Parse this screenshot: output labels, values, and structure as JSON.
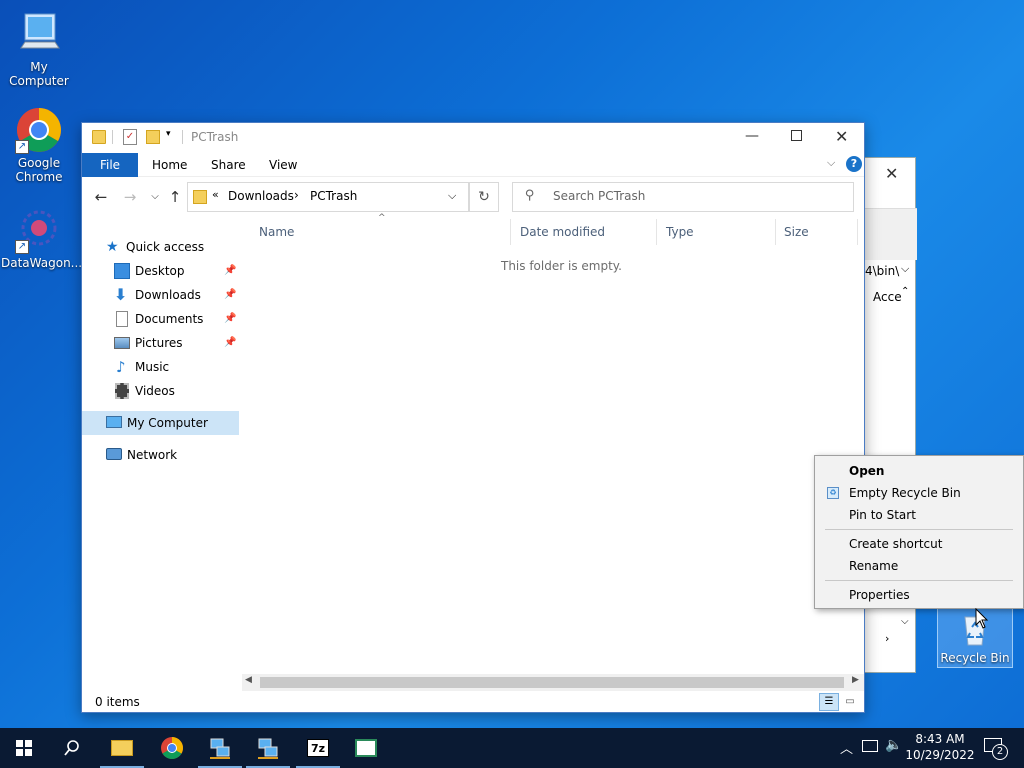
{
  "desktop": {
    "icons": [
      {
        "label": "My Computer"
      },
      {
        "label": "Google Chrome"
      },
      {
        "label": "DataWagon..."
      },
      {
        "label": "Recycle Bin"
      }
    ]
  },
  "back_window": {
    "path_fragment": "4\\bin\\",
    "column_fragment": "Acce"
  },
  "explorer": {
    "title": "PCTrash",
    "ribbon": {
      "file": "File",
      "tabs": [
        "Home",
        "Share",
        "View"
      ]
    },
    "address": {
      "crumbs": [
        "Downloads",
        "PCTrash"
      ],
      "overflow": "«"
    },
    "search_placeholder": "Search PCTrash",
    "nav": {
      "quick_access": "Quick access",
      "items": [
        "Desktop",
        "Downloads",
        "Documents",
        "Pictures",
        "Music",
        "Videos"
      ],
      "my_computer": "My Computer",
      "network": "Network"
    },
    "columns": [
      "Name",
      "Date modified",
      "Type",
      "Size"
    ],
    "empty_message": "This folder is empty.",
    "status": "0 items"
  },
  "context_menu": {
    "items": [
      "Open",
      "Empty Recycle Bin",
      "Pin to Start",
      "Create shortcut",
      "Rename",
      "Properties"
    ]
  },
  "taskbar": {
    "time": "8:43 AM",
    "date": "10/29/2022",
    "notification_count": "2"
  },
  "colors": {
    "accent": "#1a73c9",
    "file_tab": "#1565c0",
    "selection": "#cce4f7",
    "taskbar": "#0a1a33"
  }
}
